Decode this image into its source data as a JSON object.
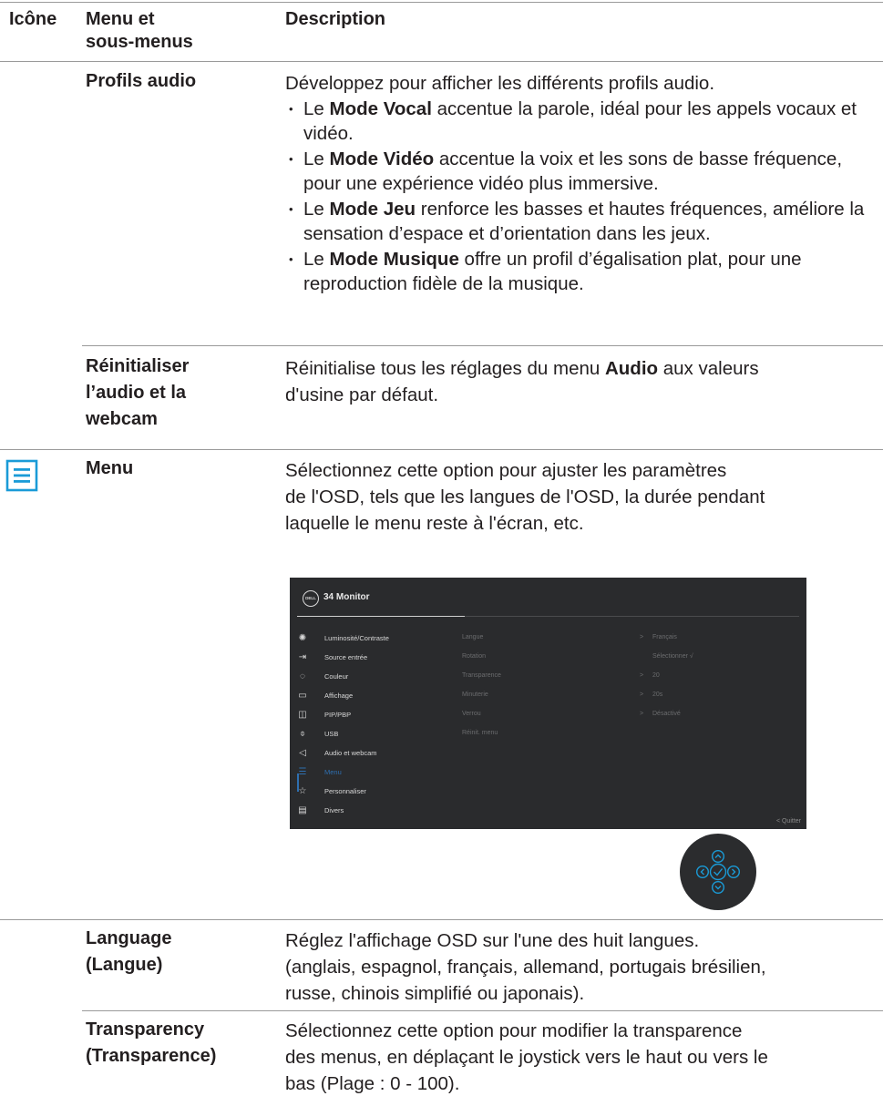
{
  "header": {
    "col_icon": "Icône",
    "col_menu_l1": "Menu et",
    "col_menu_l2": "sous-menus",
    "col_desc": "Description"
  },
  "rows": {
    "audio_profiles": {
      "name": "Profils audio",
      "intro": "Développez pour afficher les différents profils audio.",
      "bullets": [
        {
          "pre": "Le ",
          "bold": "Mode Vocal",
          "post": " accentue la parole, idéal pour les appels vocaux et vidéo."
        },
        {
          "pre": "Le ",
          "bold": "Mode Vidéo",
          "post": " accentue la voix et les sons de basse fréquence, pour une expérience vidéo plus immersive."
        },
        {
          "pre": "Le ",
          "bold": "Mode Jeu",
          "post": " renforce les basses et hautes fréquences, améliore la sensation d’espace et d’orientation dans les jeux."
        },
        {
          "pre": "Le ",
          "bold": "Mode Musique",
          "post": " offre un profil d’égalisation plat, pour une reproduction fidèle de la musique."
        }
      ]
    },
    "reset_audio": {
      "name_l1": "Réinitialiser",
      "name_l2": "l’audio et la",
      "name_l3": "webcam",
      "desc_pre": "Réinitialise tous les réglages du menu ",
      "desc_bold": "Audio",
      "desc_post_l1": " aux valeurs",
      "desc_l2": "d'usine par défaut."
    },
    "menu": {
      "icon": "menu-list-icon",
      "name": "Menu",
      "desc_l1": "Sélectionnez cette option pour ajuster les paramètres",
      "desc_l2": "de l'OSD, tels que les langues de l'OSD, la durée pendant",
      "desc_l3": "laquelle le menu reste à l'écran, etc."
    },
    "language": {
      "name_l1": "Language",
      "name_l2": "(Langue)",
      "desc_l1": "Réglez l'affichage OSD sur l'une des huit langues.",
      "desc_l2": "(anglais, espagnol, français, allemand, portugais brésilien,",
      "desc_l3": "russe, chinois simplifié ou japonais)."
    },
    "transparency": {
      "name_l1": "Transparency",
      "name_l2": "(Transparence)",
      "desc_l1": "Sélectionnez cette option pour modifier la transparence",
      "desc_l2": "des menus, en déplaçant le joystick vers le haut ou vers le",
      "desc_l3": "bas (Plage : 0 - 100)."
    }
  },
  "osd": {
    "logo": "DELL",
    "title": "34 Monitor",
    "items": [
      {
        "label": "Luminosité/Contraste",
        "icon": "brightness-icon"
      },
      {
        "label": "Source entrée",
        "icon": "input-source-icon"
      },
      {
        "label": "Couleur",
        "icon": "color-palette-icon"
      },
      {
        "label": "Affichage",
        "icon": "display-icon"
      },
      {
        "label": "PIP/PBP",
        "icon": "pip-icon"
      },
      {
        "label": "USB",
        "icon": "usb-mouse-icon"
      },
      {
        "label": "Audio et webcam",
        "icon": "speaker-icon"
      },
      {
        "label": "Menu",
        "icon": "menu-icon",
        "active": true
      },
      {
        "label": "Personnaliser",
        "icon": "star-icon"
      },
      {
        "label": "Divers",
        "icon": "others-icon"
      }
    ],
    "submenu": [
      {
        "label": "Langue",
        "arrow": ">",
        "value": "Français"
      },
      {
        "label": "Rotation",
        "arrow": "",
        "value": "Sélectionner √"
      },
      {
        "label": "Transparence",
        "arrow": ">",
        "value": "20"
      },
      {
        "label": "Minuterie",
        "arrow": ">",
        "value": "20s"
      },
      {
        "label": "Verrou",
        "arrow": ">",
        "value": "Désactivé"
      },
      {
        "label": "Réinit. menu",
        "arrow": "",
        "value": ""
      }
    ],
    "quit": "< Quitter",
    "accent": "#2e6fb0"
  },
  "joystick": {
    "icon": "joystick-icon",
    "color": "#1a9bd7"
  }
}
